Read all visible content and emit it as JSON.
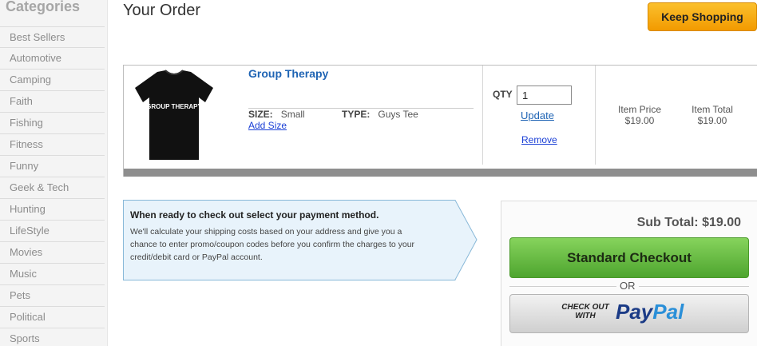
{
  "sidebar": {
    "title": "Categories",
    "items": [
      "Best Sellers",
      "Automotive",
      "Camping",
      "Faith",
      "Fishing",
      "Fitness",
      "Funny",
      "Geek & Tech",
      "Hunting",
      "LifeStyle",
      "Movies",
      "Music",
      "Pets",
      "Political",
      "Sports"
    ]
  },
  "header": {
    "title": "Your Order",
    "keep_shopping": "Keep Shopping"
  },
  "order": {
    "product": {
      "name": "Group Therapy",
      "shirt_text": "GROUP THERAPY",
      "size_label": "SIZE:",
      "size_value": "Small",
      "type_label": "TYPE:",
      "type_value": "Guys Tee",
      "add_size": "Add Size"
    },
    "qty_label": "QTY",
    "qty_value": "1",
    "update": "Update",
    "remove": "Remove",
    "item_price_label": "Item Price",
    "item_price": "$19.00",
    "item_total_label": "Item Total",
    "item_total": "$19.00"
  },
  "info": {
    "title": "When ready to check out select your payment method.",
    "text": "We'll calculate your shipping costs based on your address and give you a chance to enter promo/coupon codes before you confirm the charges to your credit/debit card or PayPal account."
  },
  "checkout": {
    "subtotal": "Sub Total: $19.00",
    "standard": "Standard Checkout",
    "or": "OR",
    "paypal_small_1": "CHECK OUT",
    "paypal_small_2": "WITH",
    "paypal_pay": "Pay",
    "paypal_pal": "Pal"
  },
  "colors": {
    "accent_orange": "#f5a800",
    "link_blue": "#1f64b4",
    "checkout_green": "#5cb83a",
    "paypal_dark": "#1b3b86",
    "paypal_light": "#2a8fd8"
  }
}
